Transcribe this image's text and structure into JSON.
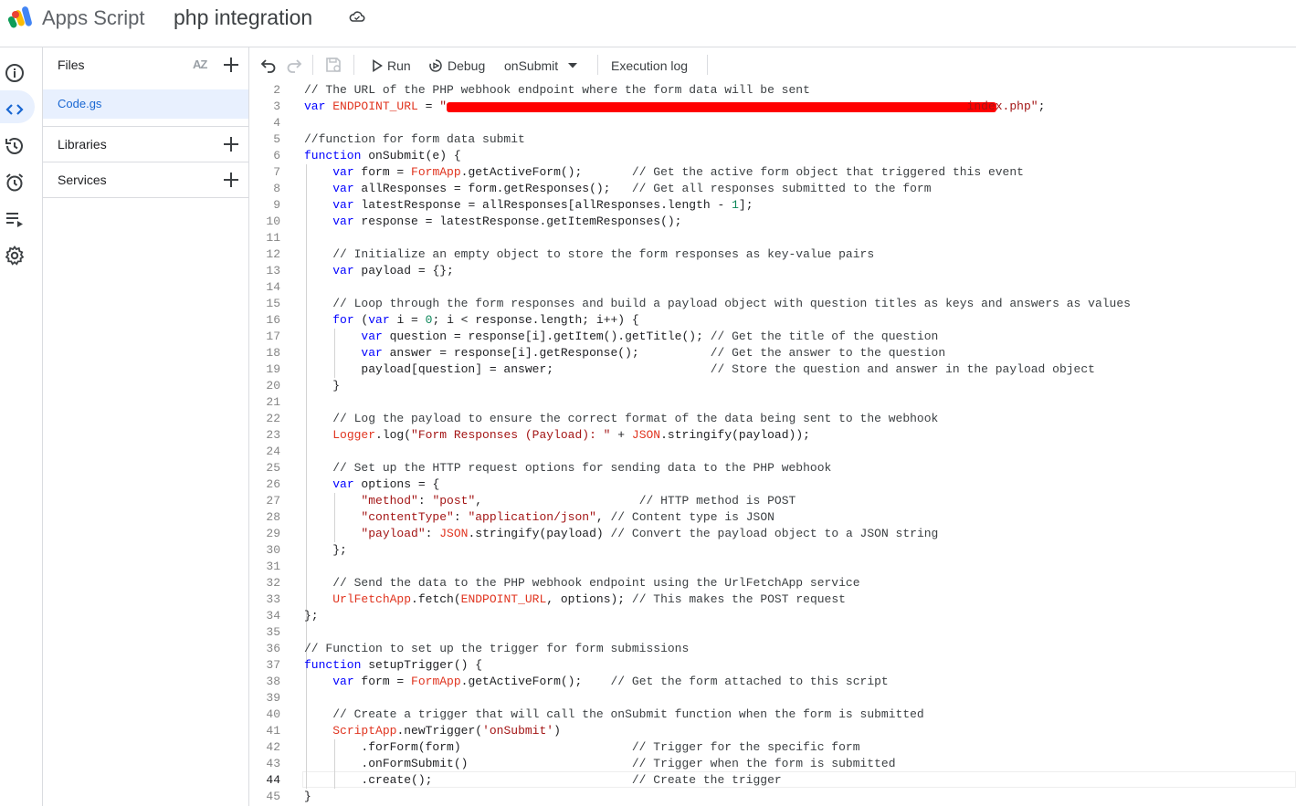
{
  "header": {
    "app_name": "Apps Script",
    "project_name": "php integration"
  },
  "sidebar": {
    "files_title": "Files",
    "sort_label": "AZ",
    "file": "Code.gs",
    "libraries_title": "Libraries",
    "services_title": "Services"
  },
  "toolbar": {
    "run_label": "Run",
    "debug_label": "Debug",
    "function_select": "onSubmit",
    "execution_log_label": "Execution log"
  },
  "editor": {
    "current_line": 44,
    "lines": [
      {
        "n": 2,
        "text": "// The URL of the PHP webhook endpoint where the form data will be sent"
      },
      {
        "n": 3,
        "text": "var ENDPOINT_URL = \"                                                                         index.php\";"
      },
      {
        "n": 4,
        "text": ""
      },
      {
        "n": 5,
        "text": "//function for form data submit"
      },
      {
        "n": 6,
        "text": "function onSubmit(e) {"
      },
      {
        "n": 7,
        "text": "    var form = FormApp.getActiveForm();       // Get the active form object that triggered this event"
      },
      {
        "n": 8,
        "text": "    var allResponses = form.getResponses();   // Get all responses submitted to the form"
      },
      {
        "n": 9,
        "text": "    var latestResponse = allResponses[allResponses.length - 1];"
      },
      {
        "n": 10,
        "text": "    var response = latestResponse.getItemResponses();"
      },
      {
        "n": 11,
        "text": ""
      },
      {
        "n": 12,
        "text": "    // Initialize an empty object to store the form responses as key-value pairs"
      },
      {
        "n": 13,
        "text": "    var payload = {};"
      },
      {
        "n": 14,
        "text": ""
      },
      {
        "n": 15,
        "text": "    // Loop through the form responses and build a payload object with question titles as keys and answers as values"
      },
      {
        "n": 16,
        "text": "    for (var i = 0; i < response.length; i++) {"
      },
      {
        "n": 17,
        "text": "        var question = response[i].getItem().getTitle(); // Get the title of the question"
      },
      {
        "n": 18,
        "text": "        var answer = response[i].getResponse();          // Get the answer to the question"
      },
      {
        "n": 19,
        "text": "        payload[question] = answer;                      // Store the question and answer in the payload object"
      },
      {
        "n": 20,
        "text": "    }"
      },
      {
        "n": 21,
        "text": ""
      },
      {
        "n": 22,
        "text": "    // Log the payload to ensure the correct format of the data being sent to the webhook"
      },
      {
        "n": 23,
        "text": "    Logger.log(\"Form Responses (Payload): \" + JSON.stringify(payload));"
      },
      {
        "n": 24,
        "text": ""
      },
      {
        "n": 25,
        "text": "    // Set up the HTTP request options for sending data to the PHP webhook"
      },
      {
        "n": 26,
        "text": "    var options = {"
      },
      {
        "n": 27,
        "text": "        \"method\": \"post\",                      // HTTP method is POST"
      },
      {
        "n": 28,
        "text": "        \"contentType\": \"application/json\", // Content type is JSON"
      },
      {
        "n": 29,
        "text": "        \"payload\": JSON.stringify(payload) // Convert the payload object to a JSON string"
      },
      {
        "n": 30,
        "text": "    };"
      },
      {
        "n": 31,
        "text": ""
      },
      {
        "n": 32,
        "text": "    // Send the data to the PHP webhook endpoint using the UrlFetchApp service"
      },
      {
        "n": 33,
        "text": "    UrlFetchApp.fetch(ENDPOINT_URL, options); // This makes the POST request"
      },
      {
        "n": 34,
        "text": "};"
      },
      {
        "n": 35,
        "text": ""
      },
      {
        "n": 36,
        "text": "// Function to set up the trigger for form submissions"
      },
      {
        "n": 37,
        "text": "function setupTrigger() {"
      },
      {
        "n": 38,
        "text": "    var form = FormApp.getActiveForm();    // Get the form attached to this script"
      },
      {
        "n": 39,
        "text": ""
      },
      {
        "n": 40,
        "text": "    // Create a trigger that will call the onSubmit function when the form is submitted"
      },
      {
        "n": 41,
        "text": "    ScriptApp.newTrigger('onSubmit')"
      },
      {
        "n": 42,
        "text": "        .forForm(form)                        // Trigger for the specific form"
      },
      {
        "n": 43,
        "text": "        .onFormSubmit()                       // Trigger when the form is submitted"
      },
      {
        "n": 44,
        "text": "        .create();                            // Create the trigger"
      },
      {
        "n": 45,
        "text": "}"
      }
    ]
  }
}
